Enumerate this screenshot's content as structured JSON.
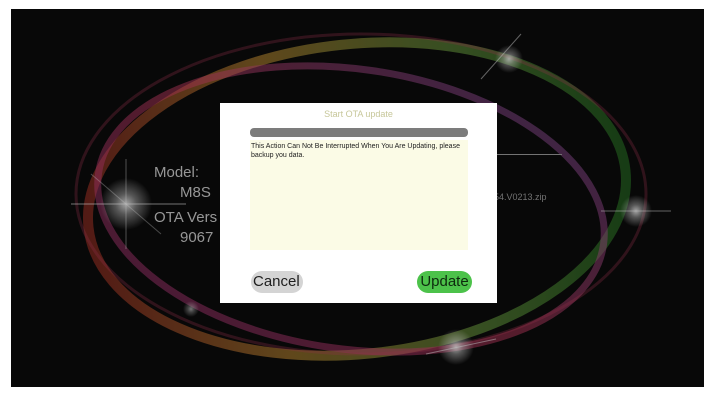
{
  "background": {
    "model_label": "Model:",
    "model_value": "M8S",
    "ota_label": "OTA Vers",
    "ota_value": "9067",
    "file_name": "54.V0213.zip"
  },
  "dialog": {
    "title": "Start OTA update",
    "progress_fraction": 0,
    "message": "This Action Can Not Be Interrupted When You Are Updating, please backup you data.",
    "cancel_label": "Cancel",
    "update_label": "Update"
  },
  "colors": {
    "update_button": "#4cc24a",
    "cancel_button": "#d4d4d4",
    "message_area": "#fbfbe6",
    "progress_track": "#7c7c7c"
  }
}
